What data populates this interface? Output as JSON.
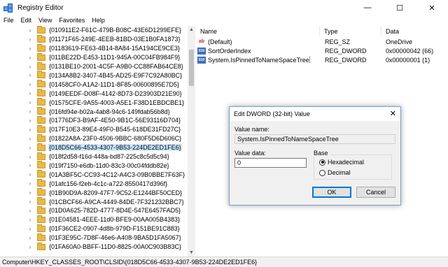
{
  "window": {
    "title": "Registry Editor",
    "controls": {
      "minimize": "—",
      "maximize": "☐",
      "close": "✕"
    }
  },
  "menu": [
    "File",
    "Edit",
    "View",
    "Favorites",
    "Help"
  ],
  "tree": {
    "items": [
      "{010911E2-F61C-479B-B08C-43E6D1299EFE}",
      "{01171F65-249E-4EEB-81BD-03E1B0FA1873}",
      "{0118361​9-FE63-4B14-8A84-15A194CE9CE3}",
      "{011BE22D-E453-11D1-945A-00C04FB984F9}",
      "{0131BE10-2001-4C5F-A9B0-CC88FAB64CE8}",
      "{0134A8B2-3407-4B45-AD25-E9F7C92A80BC}",
      "{01458CF0-A1A2-11D1-8F85-00600895E7D5}",
      "{0149EEDF-D08F-4142-8D73-D23903D21E90}",
      "{01575CFE-9A55-4003-A5E1-F38D1EBDCBE1}",
      "{016fd94e-b02a-4ab8-94c6-149fdab56b8d}",
      "{01776DF3-B9AF-4E50-9B1C-56E93116D704}",
      "{017F10E3-89E4-49F0-B545-618DE31FD27C}",
      "{01822A8A-23F0-4506-9BBC-680F5D6D606C}",
      "{018D5C66-4533-4307-9B53-224DE2ED1FE6}",
      "{018f2d58-f16d-448a-bd87-225c8c5d5c94}",
      "{019f7150-e6db-11d0-83c3-00c04fddb82e}",
      "{01A3BF5C-CC93-4C12-A4C3-09B0BBE7F63F}",
      "{01afc156-f2eb-4c1c-a722-8550417d396f}",
      "{01B90D9A-8209-47F7-9C52-E1244BF50CED}",
      "{01CBCF66-A9CA-4449-84DE-7F321232BBC7}",
      "{01D0A625-782D-4777-8D4E-547E6457FAD5}",
      "{01E04581-4EEE-11d0-BFE9-00AA005B4383}",
      "{01F36CE2-0907-4d8b-979D-F151BE91C883}",
      "{01F3E95C-7D8F-46e6-A408-9BA5D1FA5067}",
      "{01FA60A0-BBFF-11D0-8825-00A0C903B83C}"
    ],
    "selected_index": 13,
    "expander": "›"
  },
  "list": {
    "headers": {
      "name": "Name",
      "type": "Type",
      "data": "Data"
    },
    "rows": [
      {
        "icon": "ab",
        "name": "(Default)",
        "type": "REG_SZ",
        "data": "OneDrive"
      },
      {
        "icon": "010",
        "name": "SortOrderIndex",
        "type": "REG_DWORD",
        "data": "0x00000042 (66)"
      },
      {
        "icon": "010",
        "name": "System.IsPinnedToNameSpaceTree",
        "type": "REG_DWORD",
        "data": "0x00000001 (1)"
      }
    ]
  },
  "status": {
    "path": "Computer\\HKEY_CLASSES_ROOT\\CLSID\\{018D5C66-4533-4307-9B53-224DE2ED1FE6}"
  },
  "dialog": {
    "title": "Edit DWORD (32-bit) Value",
    "close": "✕",
    "value_name_label": "Value name:",
    "value_name": "System.IsPinnedToNameSpaceTree",
    "value_data_label": "Value data:",
    "value_data": "0",
    "base_label": "Base",
    "radio_hex": "Hexadecimal",
    "radio_dec": "Decimal",
    "ok": "OK",
    "cancel": "Cancel"
  },
  "colors": {
    "selection": "#cce8ff",
    "accent": "#0078d7",
    "folder": "#e8b94a"
  }
}
